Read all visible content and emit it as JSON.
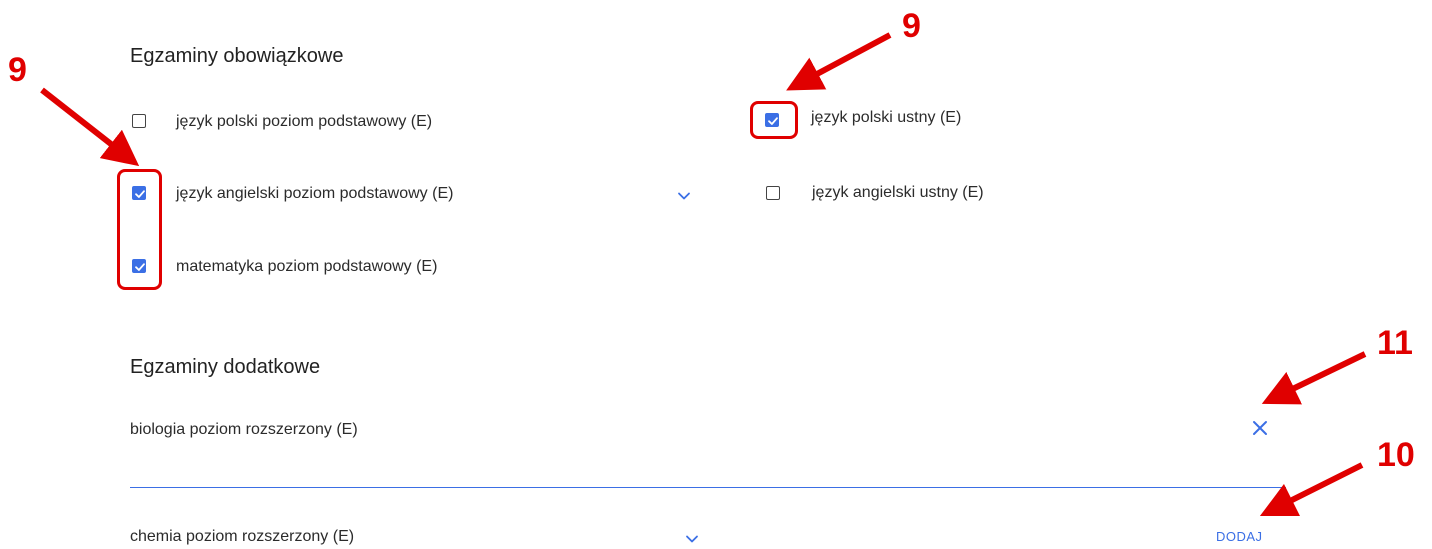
{
  "mandatory": {
    "title": "Egzaminy obowiązkowe",
    "items": [
      {
        "label": "język polski poziom podstawowy (E)",
        "checked": false
      },
      {
        "label": "język polski ustny (E)",
        "checked": true
      },
      {
        "label": "język angielski poziom podstawowy (E)",
        "checked": true
      },
      {
        "label": "język angielski ustny (E)",
        "checked": false
      },
      {
        "label": "matematyka poziom podstawowy (E)",
        "checked": true
      }
    ]
  },
  "additional": {
    "title": "Egzaminy dodatkowe",
    "selected_exam": "biologia poziom rozszerzony (E)",
    "new_exam_value": "chemia poziom rozszerzony (E)",
    "add_label": "DODAJ"
  },
  "annotations": {
    "n9": "9",
    "n10": "10",
    "n11": "11"
  },
  "colors": {
    "accent": "#3b6fe5",
    "annotation": "#e00000"
  },
  "icons": [
    "checkbox",
    "checkbox-checked",
    "chevron-down-icon",
    "close-icon",
    "arrow-icon"
  ]
}
